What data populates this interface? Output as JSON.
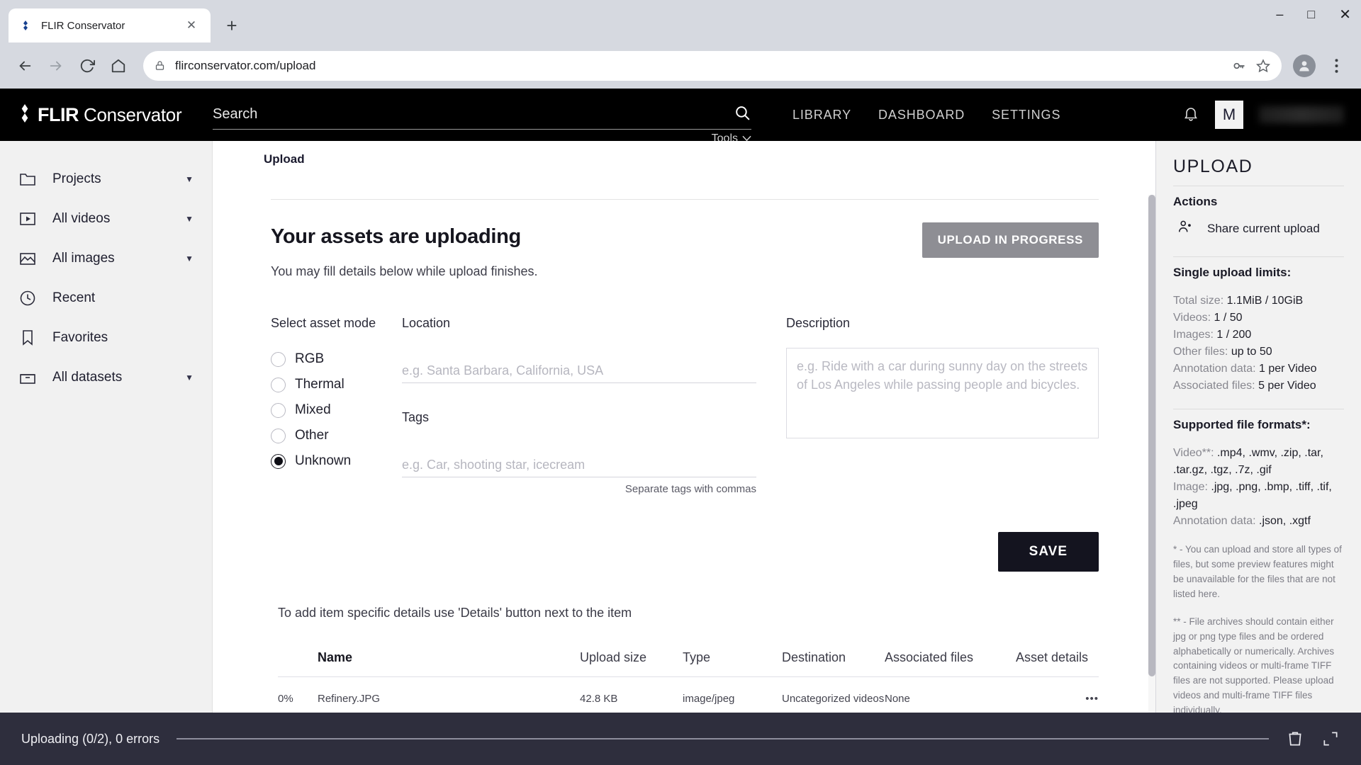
{
  "browser": {
    "tab": {
      "title": "FLIR Conservator",
      "favicon_icon": "flir-diamond-icon",
      "close_icon": "close-icon"
    },
    "new_tab_label": "+",
    "nav": {
      "back_icon": "back-arrow-icon",
      "forward_icon": "forward-arrow-icon",
      "reload_icon": "reload-icon",
      "home_icon": "home-icon"
    },
    "omnibox": {
      "lock_icon": "lock-icon",
      "url": "flirconservator.com/upload",
      "key_icon": "password-key-icon",
      "star_icon": "bookmark-star-icon"
    },
    "window": {
      "minimize": "–",
      "maximize": "□",
      "close": "✕",
      "menu_icon": "kebab-menu-icon"
    }
  },
  "app_header": {
    "brand_primary": "FLIR",
    "brand_secondary": "Conservator",
    "search_placeholder": "Search",
    "search_icon": "search-icon",
    "tools_label": "Tools",
    "tools_caret": "∨",
    "nav_items": [
      "LIBRARY",
      "DASHBOARD",
      "SETTINGS"
    ],
    "bell_icon": "notification-bell-icon",
    "avatar_initial": "M"
  },
  "sidebar": {
    "items": [
      {
        "label": "Projects",
        "icon": "folder-icon",
        "caret": true
      },
      {
        "label": "All videos",
        "icon": "video-play-icon",
        "caret": true
      },
      {
        "label": "All images",
        "icon": "image-icon",
        "caret": true
      },
      {
        "label": "Recent",
        "icon": "clock-icon",
        "caret": false
      },
      {
        "label": "Favorites",
        "icon": "bookmark-icon",
        "caret": false
      },
      {
        "label": "All datasets",
        "icon": "dataset-box-icon",
        "caret": true
      }
    ]
  },
  "main": {
    "breadcrumb": "Upload",
    "card_title": "Your assets are uploading",
    "card_subtitle": "You may fill details below while upload finishes.",
    "progress_button": "UPLOAD IN PROGRESS",
    "asset_mode": {
      "label": "Select asset mode",
      "options": [
        "RGB",
        "Thermal",
        "Mixed",
        "Other",
        "Unknown"
      ],
      "selected": "Unknown"
    },
    "location": {
      "label": "Location",
      "value": "",
      "placeholder": "e.g. Santa Barbara, California, USA"
    },
    "tags": {
      "label": "Tags",
      "value": "",
      "placeholder": "e.g. Car, shooting star, icecream",
      "hint": "Separate tags with commas"
    },
    "description": {
      "label": "Description",
      "value": "",
      "placeholder": "e.g. Ride with a car during sunny day on the streets of Los Angeles while passing people and bicycles."
    },
    "save_button": "SAVE",
    "details_note": "To add item specific details use 'Details' button next to the item",
    "table": {
      "columns": [
        "",
        "Name",
        "Upload size",
        "Type",
        "Destination",
        "Associated files",
        "Asset details"
      ],
      "rows": [
        {
          "progress": "0%",
          "name": "Refinery.JPG",
          "upload_size": "42.8 KB",
          "type": "image/jpeg",
          "destination": "Uncategorized videos",
          "associated_files": "None",
          "asset_details_icon": "ellipsis-icon"
        }
      ]
    }
  },
  "right_panel": {
    "title": "UPLOAD",
    "actions_heading": "Actions",
    "share_action": {
      "label": "Share current upload",
      "icon": "share-user-icon"
    },
    "limits_heading": "Single upload limits:",
    "limits": [
      {
        "label": "Total size:",
        "value": "1.1MiB / 10GiB"
      },
      {
        "label": "Videos:",
        "value": "1 / 50"
      },
      {
        "label": "Images:",
        "value": "1 / 200"
      },
      {
        "label": "Other files:",
        "value": "up to 50"
      },
      {
        "label": "Annotation data:",
        "value": "1 per Video"
      },
      {
        "label": "Associated files:",
        "value": "5 per Video"
      }
    ],
    "formats_heading": "Supported file formats*:",
    "formats": [
      {
        "label": "Video**:",
        "value": ".mp4, .wmv, .zip, .tar, .tar.gz, .tgz, .7z, .gif"
      },
      {
        "label": "Image:",
        "value": ".jpg, .png, .bmp, .tiff, .tif, .jpeg"
      },
      {
        "label": "Annotation data:",
        "value": ".json, .xgtf"
      }
    ],
    "note_one": "* - You can upload and store all types of files, but some preview features might be unavailable for the files that are not listed here.",
    "note_two": "** - File archives should contain either jpg or png type files and be ordered alphabetically or numerically. Archives containing videos or multi-frame TIFF files are not supported. Please upload videos and multi-frame TIFF files individually."
  },
  "status_bar": {
    "text": "Uploading (0/2), 0 errors",
    "progress_percent": 0,
    "delete_icon": "trash-icon",
    "expand_icon": "expand-icon"
  },
  "colors": {
    "header_bg": "#000000",
    "sidebar_bg": "#f1f1f1",
    "status_bg": "#2e2e3d",
    "save_btn": "#14141f",
    "progress_btn": "#8e8e94"
  }
}
